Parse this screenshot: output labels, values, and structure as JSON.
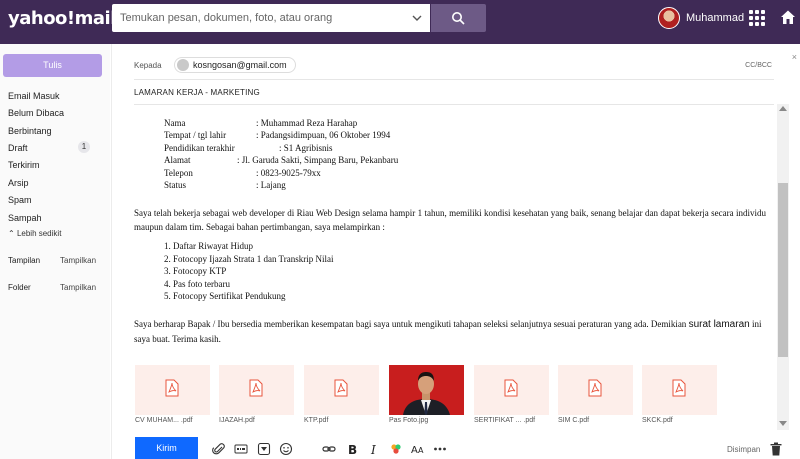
{
  "header": {
    "logo": "yahoo!mail",
    "search_placeholder": "Temukan pesan, dokumen, foto, atau orang",
    "username": "Muhammad"
  },
  "sidebar": {
    "compose_label": "Tulis",
    "items": [
      {
        "label": "Email Masuk"
      },
      {
        "label": "Belum Dibaca"
      },
      {
        "label": "Berbintang"
      },
      {
        "label": "Draft",
        "count": "1"
      },
      {
        "label": "Terkirim"
      },
      {
        "label": "Arsip"
      },
      {
        "label": "Spam"
      },
      {
        "label": "Sampah"
      }
    ],
    "less_label": "Lebih sedikit",
    "sections": [
      {
        "label": "Tampilan",
        "action": "Tampilkan"
      },
      {
        "label": "Folder",
        "action": "Tampilkan"
      }
    ]
  },
  "compose": {
    "to_label": "Kepada",
    "recipient": "kosngosan@gmail.com",
    "ccbcc_label": "CC/BCC",
    "close_label": "×",
    "subject": "LAMARAN KERJA - MARKETING",
    "info": [
      {
        "label": "Nama",
        "value": ": Muhammad Reza Harahap"
      },
      {
        "label": "Tempat / tgl lahir",
        "value": ": Padangsidimpuan, 06 Oktober 1994"
      },
      {
        "label": "Pendidikan terakhir",
        "value": ": S1 Agribisnis"
      },
      {
        "label": "Alamat",
        "value": ": Jl. Garuda Sakti, Simpang Baru, Pekanbaru"
      },
      {
        "label": "Telepon",
        "value": ": 0823-9025-79xx"
      },
      {
        "label": "Status",
        "value": ": Lajang"
      }
    ],
    "paragraph1": "Saya telah bekerja sebagai web developer di Riau Web Design selama hampir 1 tahun, memiliki kondisi kesehatan yang baik, senang belajar dan dapat bekerja secara individu maupun dalam tim. Sebagai bahan pertimbangan, saya melampirkan :",
    "list": [
      "1. Daftar Riwayat Hidup",
      "2. Fotocopy Ijazah Strata 1 dan Transkrip Nilai",
      "3. Fotocopy KTP",
      "4. Pas foto terbaru",
      "5. Fotocopy Sertifikat Pendukung"
    ],
    "paragraph2_a": "Saya berharap Bapak / Ibu bersedia memberikan kesempatan bagi saya untuk mengikuti tahapan seleksi selanjutnya sesuai peraturan yang ada. Demikian ",
    "paragraph2_b": "surat lamaran",
    "paragraph2_c": " ini saya buat. Terima kasih.",
    "attachments": [
      {
        "name": "CV MUHAM... .pdf",
        "type": "pdf"
      },
      {
        "name": "IJAZAH.pdf",
        "type": "pdf"
      },
      {
        "name": "KTP.pdf",
        "type": "pdf"
      },
      {
        "name": "Pas Foto.jpg",
        "type": "image"
      },
      {
        "name": "SERTIFIKAT ... .pdf",
        "type": "pdf"
      },
      {
        "name": "SIM C.pdf",
        "type": "pdf"
      },
      {
        "name": "SKCK.pdf",
        "type": "pdf"
      }
    ],
    "send_label": "Kirim",
    "saved_label": "Disimpan",
    "toolbar_icons": [
      "attach-icon",
      "gif-icon",
      "sticker-icon",
      "emoji-icon",
      "link-icon",
      "bold-icon",
      "italic-icon",
      "color-icon",
      "font-size-icon",
      "more-icon",
      "trash-icon"
    ]
  },
  "colors": {
    "header_bg": "#3f2a56",
    "compose_button": "#b39ce6",
    "send_button": "#0f69ff",
    "attachment_bg": "#fdeeea",
    "pdf_icon": "#e8543c"
  }
}
